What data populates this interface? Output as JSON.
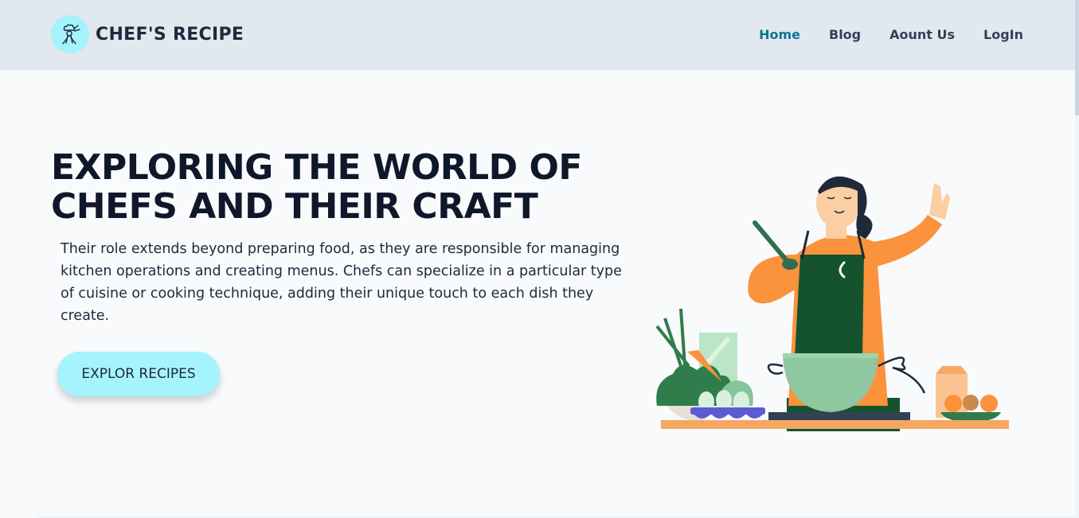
{
  "nav": {
    "brand": "CHEF'S RECIPE",
    "links": [
      {
        "label": "Home",
        "active": true
      },
      {
        "label": "Blog",
        "active": false
      },
      {
        "label": "Aount Us",
        "active": false
      },
      {
        "label": "LogIn",
        "active": false
      }
    ]
  },
  "hero": {
    "title_line1": "EXPLORING THE WORLD OF",
    "title_line2": "CHEFS AND THEIR CRAFT",
    "description": "Their role extends beyond preparing food, as they are responsible for managing kitchen operations and creating menus. Chefs can specialize in a particular type of cuisine or cooking technique, adding their unique touch to each dish they create.",
    "cta_label": "EXPLOR RECIPES"
  },
  "colors": {
    "navbar_bg": "#e2e8f0",
    "accent_cyan": "#a5f3fc",
    "active_link": "#0e7490",
    "page_bg": "#f8fafc",
    "heading": "#0f172a"
  },
  "icons": {
    "logo": "chef-logo-icon",
    "illustration": "chef-cooking-illustration"
  }
}
